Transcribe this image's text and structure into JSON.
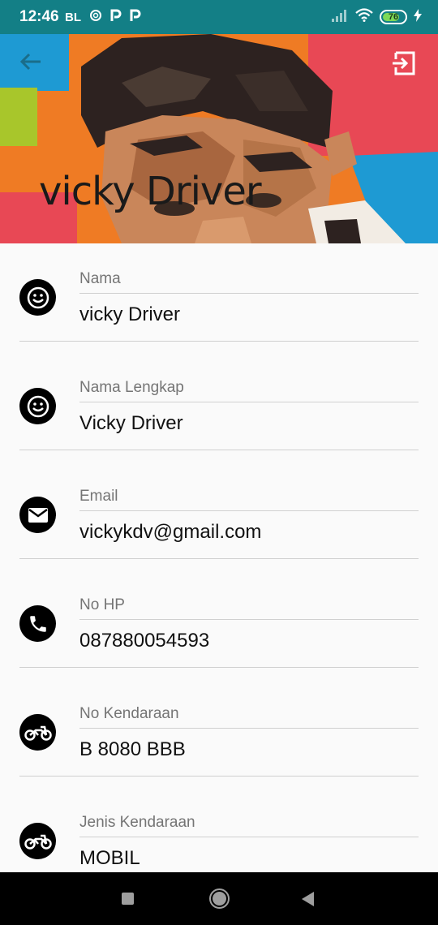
{
  "status_bar": {
    "time": "12:46",
    "carrier_label": "BL",
    "notification_icons": [
      "sync-icon",
      "p-icon",
      "p-icon"
    ],
    "battery_level": 76,
    "battery_label": "76"
  },
  "header": {
    "title": "vicky Driver",
    "back_icon": "arrow-left-icon",
    "logout_icon": "exit-icon",
    "colors": {
      "accent": "#137f86",
      "back_icon": "#1e90a8"
    }
  },
  "fields": [
    {
      "label": "Nama",
      "value": "vicky Driver",
      "icon": "smiley-icon"
    },
    {
      "label": "Nama Lengkap",
      "value": "Vicky Driver",
      "icon": "smiley-icon"
    },
    {
      "label": "Email",
      "value": "vickykdv@gmail.com",
      "icon": "mail-icon"
    },
    {
      "label": "No HP",
      "value": "087880054593",
      "icon": "phone-icon"
    },
    {
      "label": "No Kendaraan",
      "value": "B 8080 BBB",
      "icon": "motorcycle-icon"
    },
    {
      "label": "Jenis Kendaraan",
      "value": "MOBIL",
      "icon": "motorcycle-icon"
    }
  ]
}
